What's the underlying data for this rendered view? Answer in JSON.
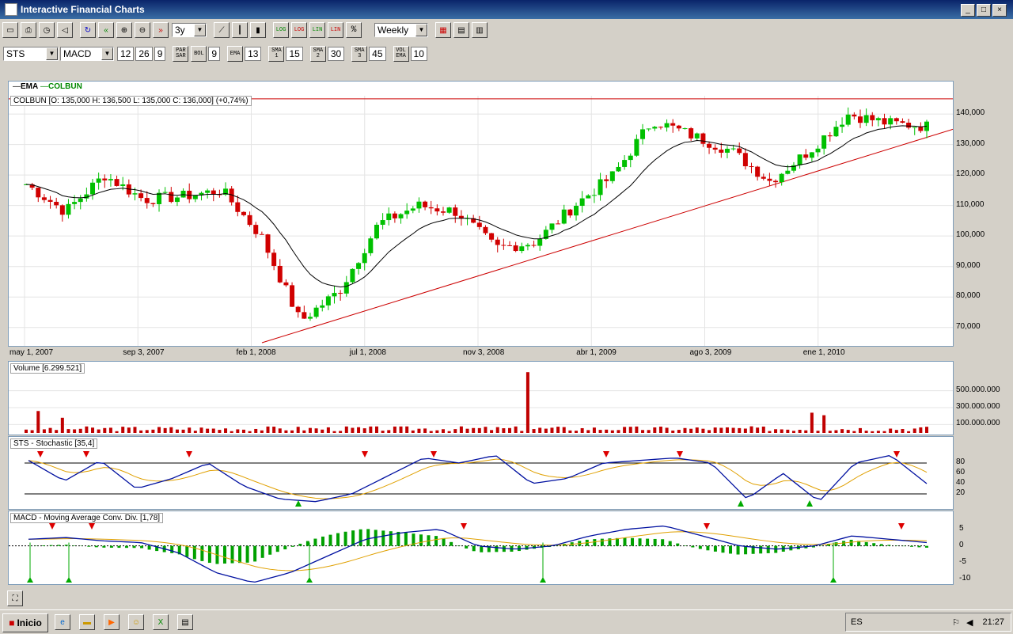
{
  "window": {
    "title": "Interactive Financial Charts"
  },
  "toolbar1": {
    "period": "3y",
    "interval": "Weekly",
    "scale_buttons": [
      "LOG",
      "LOG",
      "LIN",
      "LIN",
      "%"
    ]
  },
  "toolbar2": {
    "symbol": "STS",
    "indicator": "MACD",
    "macd_params": [
      "12",
      "26",
      "9"
    ],
    "par_sar_label": "PAR SAR",
    "bol_label": "BOL",
    "bol_value": "9",
    "ema_label": "EMA",
    "ema_value": "13",
    "sma1_label": "SMA 1",
    "sma1_value": "15",
    "sma2_label": "SMA 2",
    "sma2_value": "30",
    "sma3_label": "SMA 3",
    "sma3_value": "45",
    "volema_label": "VOL EMA",
    "volema_value": "10"
  },
  "main_chart": {
    "legend_ema": "EMA",
    "legend_symbol": "COLBUN",
    "info": "COLBUN [O: 135,000  H: 136,500  L: 135,000  C: 136,000] (+0,74%)",
    "y_ticks": [
      "140,000",
      "130,000",
      "120,000",
      "110,000",
      "100,000",
      "90,000",
      "80,000",
      "70,000"
    ],
    "x_ticks": [
      "may 1, 2007",
      "sep 3, 2007",
      "feb 1, 2008",
      "jul 1, 2008",
      "nov 3, 2008",
      "abr 1, 2009",
      "ago 3, 2009",
      "ene 1, 2010"
    ]
  },
  "volume_chart": {
    "label": "Volume [6.299.521]",
    "y_ticks": [
      "500.000.000",
      "300.000.000",
      "100.000.000"
    ]
  },
  "stochastic_chart": {
    "label": "STS - Stochastic [35,4]",
    "y_ticks": [
      "80",
      "60",
      "40",
      "20"
    ]
  },
  "macd_chart": {
    "label": "MACD - Moving Average Conv. Div. [1,78]",
    "y_ticks": [
      "5",
      "0",
      "-5",
      "-10"
    ]
  },
  "taskbar": {
    "start_label": "Inicio",
    "lang": "ES",
    "clock": "21:27"
  },
  "chart_data": [
    {
      "type": "candlestick",
      "title": "COLBUN",
      "x": [
        "may 1, 2007",
        "sep 3, 2007",
        "feb 1, 2008",
        "jul 1, 2008",
        "nov 3, 2008",
        "abr 1, 2009",
        "ago 3, 2009",
        "ene 1, 2010"
      ],
      "close_approx": [
        117000,
        108000,
        120000,
        112000,
        113000,
        115000,
        100000,
        72000,
        82000,
        104000,
        110000,
        108000,
        96000,
        98000,
        110000,
        120000,
        138000,
        133000,
        128000,
        118000,
        128000,
        140000,
        137000,
        136000
      ],
      "ylim": [
        65000,
        146000
      ],
      "resistance": 145000,
      "trendline": [
        [
          "feb 1, 2008",
          65000
        ],
        [
          "end",
          135000
        ]
      ]
    },
    {
      "type": "bar",
      "title": "Volume",
      "max": 750000000
    },
    {
      "type": "line",
      "title": "Stochastic",
      "ylim": [
        0,
        100
      ],
      "levels": [
        80,
        20
      ]
    },
    {
      "type": "line",
      "title": "MACD",
      "ylim": [
        -11,
        8
      ]
    }
  ]
}
